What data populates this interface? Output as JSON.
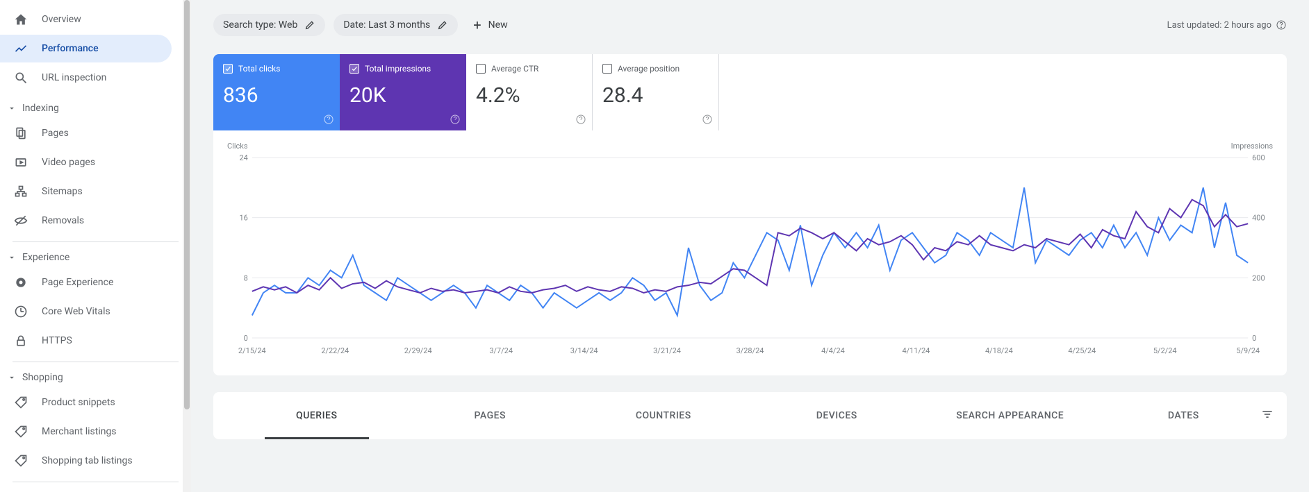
{
  "sidebar": {
    "items_top": [
      {
        "label": "Overview",
        "icon": "home"
      },
      {
        "label": "Performance",
        "icon": "chart",
        "active": true
      },
      {
        "label": "URL inspection",
        "icon": "search"
      }
    ],
    "sections": [
      {
        "title": "Indexing",
        "items": [
          {
            "label": "Pages",
            "icon": "pages"
          },
          {
            "label": "Video pages",
            "icon": "video"
          },
          {
            "label": "Sitemaps",
            "icon": "sitemap"
          },
          {
            "label": "Removals",
            "icon": "removal"
          }
        ]
      },
      {
        "title": "Experience",
        "items": [
          {
            "label": "Page Experience",
            "icon": "gear"
          },
          {
            "label": "Core Web Vitals",
            "icon": "vitals"
          },
          {
            "label": "HTTPS",
            "icon": "lock"
          }
        ]
      },
      {
        "title": "Shopping",
        "items": [
          {
            "label": "Product snippets",
            "icon": "tag"
          },
          {
            "label": "Merchant listings",
            "icon": "tag"
          },
          {
            "label": "Shopping tab listings",
            "icon": "tag"
          }
        ]
      }
    ]
  },
  "toolbar": {
    "chip_search": "Search type: Web",
    "chip_date": "Date: Last 3 months",
    "new": "New",
    "updated": "Last updated: 2 hours ago"
  },
  "metrics": {
    "clicks_label": "Total clicks",
    "clicks_value": "836",
    "impr_label": "Total impressions",
    "impr_value": "20K",
    "ctr_label": "Average CTR",
    "ctr_value": "4.2%",
    "pos_label": "Average position",
    "pos_value": "28.4"
  },
  "chart_axis": {
    "left": "Clicks",
    "right": "Impressions"
  },
  "chart_data": {
    "type": "line",
    "x_categories": [
      "2/15/24",
      "2/22/24",
      "2/29/24",
      "3/7/24",
      "3/14/24",
      "3/21/24",
      "3/28/24",
      "4/4/24",
      "4/11/24",
      "4/18/24",
      "4/25/24",
      "5/2/24",
      "5/9/24"
    ],
    "y_left": {
      "label": "Clicks",
      "ticks": [
        0,
        8,
        16,
        24
      ],
      "range": [
        0,
        24
      ]
    },
    "y_right": {
      "label": "Impressions",
      "ticks": [
        0,
        200,
        400,
        600
      ],
      "range": [
        0,
        600
      ]
    },
    "series": [
      {
        "name": "Clicks",
        "axis": "left",
        "color": "#4285f4",
        "values": [
          3,
          6,
          7,
          6,
          6,
          8,
          7,
          9,
          8,
          11,
          7,
          6,
          5,
          8,
          7,
          6,
          5,
          6,
          7,
          6,
          4,
          7,
          6,
          5,
          7,
          6,
          4,
          6,
          5,
          4,
          5,
          6,
          5,
          6,
          8,
          7,
          5,
          6,
          3,
          12,
          7,
          5,
          6,
          10,
          8,
          11,
          14,
          13,
          9,
          15,
          7,
          11,
          14,
          12,
          14,
          12,
          15,
          9,
          13,
          14,
          12,
          10,
          11,
          14,
          13,
          11,
          14,
          13,
          12,
          20,
          10,
          13,
          12,
          11,
          13,
          14,
          12,
          15,
          12,
          14,
          11,
          16,
          13,
          15,
          14,
          20,
          12,
          18,
          11,
          10
        ]
      },
      {
        "name": "Impressions",
        "axis": "right",
        "color": "#5e35b1",
        "values": [
          155,
          170,
          160,
          170,
          150,
          175,
          160,
          200,
          165,
          180,
          185,
          165,
          190,
          170,
          160,
          150,
          165,
          155,
          160,
          150,
          155,
          160,
          150,
          170,
          155,
          150,
          160,
          165,
          175,
          155,
          170,
          160,
          155,
          170,
          165,
          150,
          160,
          155,
          170,
          175,
          185,
          180,
          205,
          230,
          225,
          200,
          175,
          350,
          340,
          365,
          350,
          330,
          350,
          320,
          290,
          330,
          310,
          320,
          340,
          310,
          260,
          300,
          290,
          320,
          310,
          340,
          310,
          300,
          290,
          310,
          300,
          330,
          320,
          310,
          345,
          300,
          360,
          340,
          330,
          420,
          370,
          350,
          430,
          400,
          460,
          440,
          370,
          410,
          370,
          380
        ]
      }
    ]
  },
  "tabs": [
    "Queries",
    "Pages",
    "Countries",
    "Devices",
    "Search Appearance",
    "Dates"
  ]
}
